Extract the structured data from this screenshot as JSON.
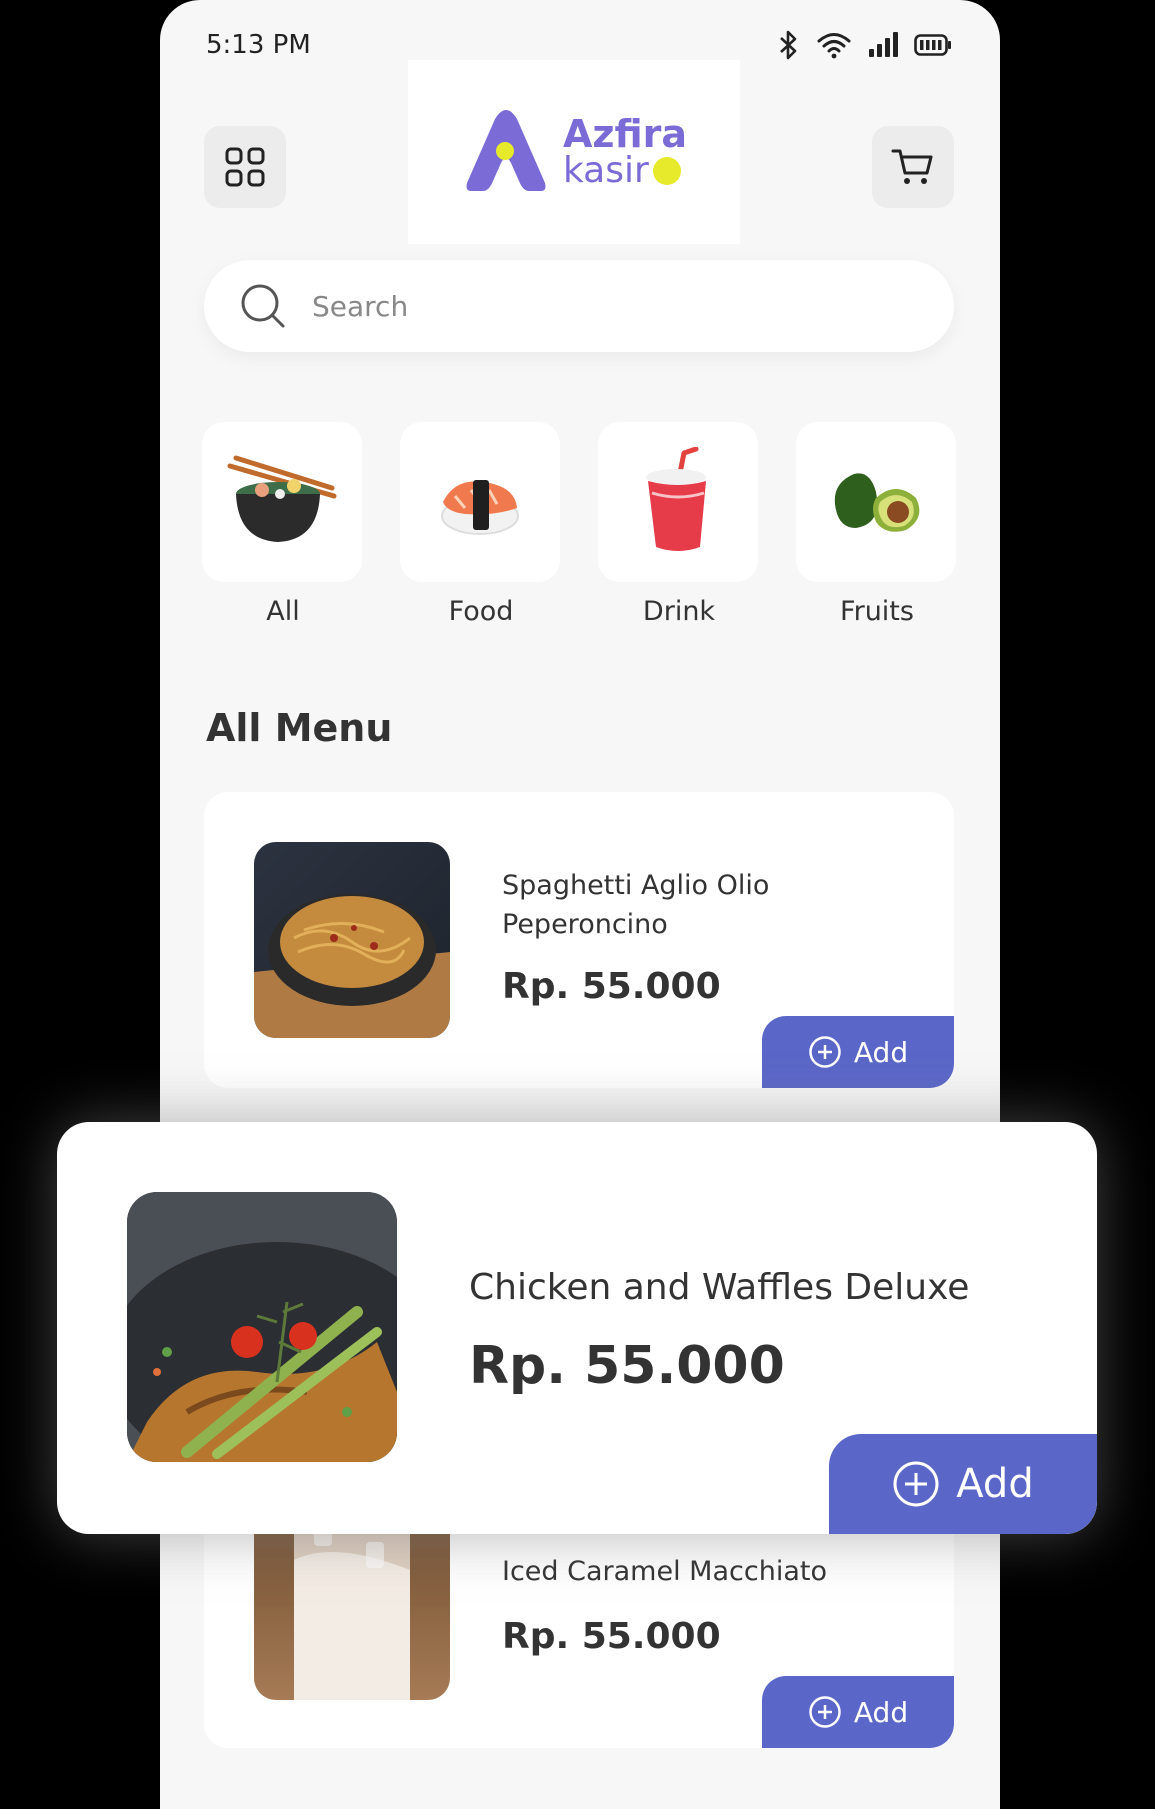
{
  "status": {
    "time": "5:13 PM"
  },
  "header": {
    "logo_line1": "Azfira",
    "logo_line2": "kasir"
  },
  "search": {
    "placeholder": "Search"
  },
  "categories": [
    {
      "label": "All",
      "icon": "noodle-bowl-icon"
    },
    {
      "label": "Food",
      "icon": "sushi-icon"
    },
    {
      "label": "Drink",
      "icon": "soda-cup-icon"
    },
    {
      "label": "Fruits",
      "icon": "avocado-icon"
    }
  ],
  "section": {
    "title": "All Menu"
  },
  "menu": [
    {
      "name_line1": "Spaghetti Aglio Olio",
      "name_line2": "Peperoncino",
      "price": "Rp. 55.000",
      "add_label": "Add"
    },
    {
      "name": "Iced Caramel Macchiato",
      "price": "Rp. 55.000",
      "add_label": "Add"
    }
  ],
  "featured": {
    "name": "Chicken and Waffles Deluxe",
    "price": "Rp. 55.000",
    "add_label": "Add"
  },
  "colors": {
    "accent": "#5b67c8",
    "brand": "#7a6bd6",
    "brand_dot": "#e6ea2b",
    "background": "#f7f7f7"
  }
}
